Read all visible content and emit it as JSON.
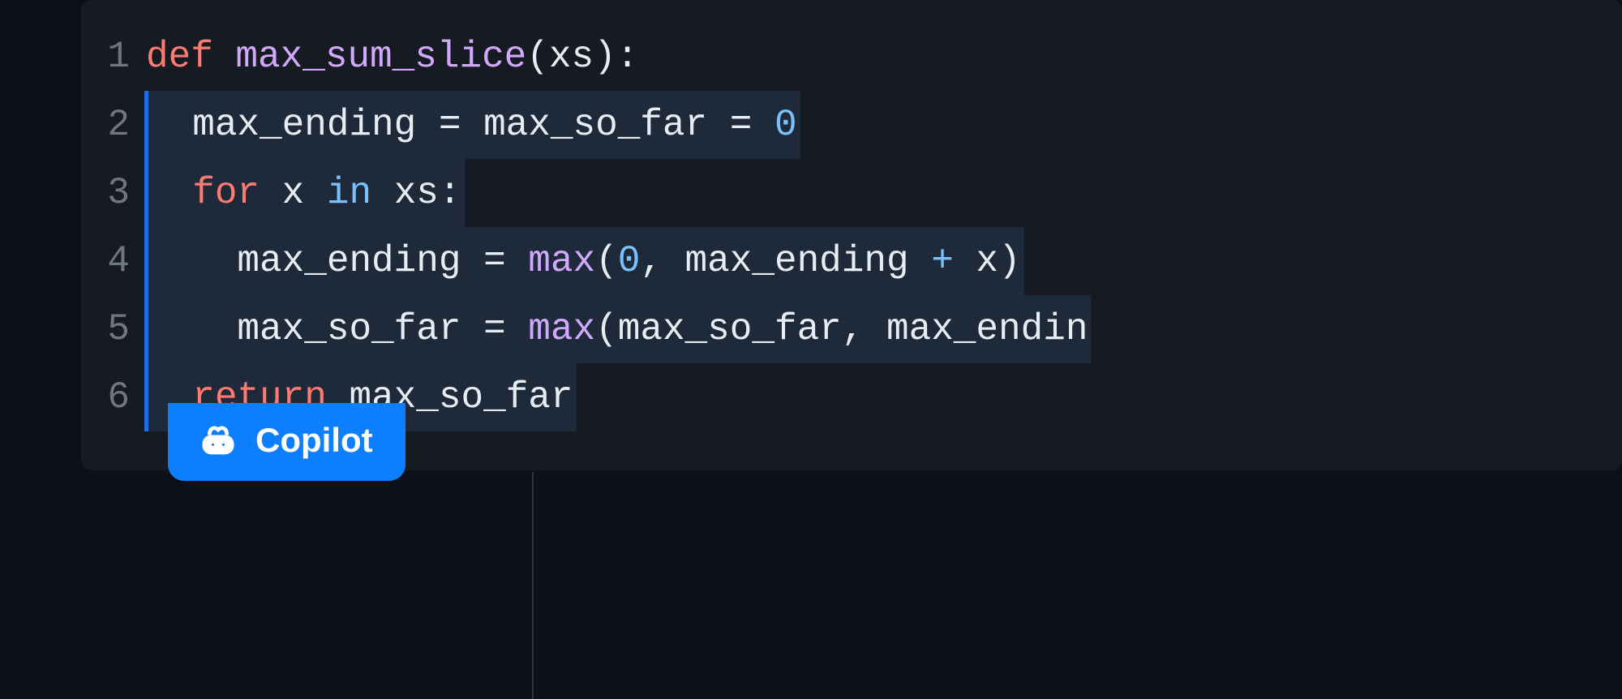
{
  "editor": {
    "lines": [
      {
        "num": "1",
        "tokens": [
          {
            "t": "def ",
            "c": "tok-keyword"
          },
          {
            "t": "max_sum_slice",
            "c": "tok-func"
          },
          {
            "t": "(xs):",
            "c": "tok-default"
          }
        ],
        "suggested": false
      },
      {
        "num": "2",
        "tokens": [
          {
            "t": "  max_ending ",
            "c": "tok-default"
          },
          {
            "t": "=",
            "c": "tok-default"
          },
          {
            "t": " max_so_far ",
            "c": "tok-default"
          },
          {
            "t": "=",
            "c": "tok-default"
          },
          {
            "t": " ",
            "c": "tok-default"
          },
          {
            "t": "0",
            "c": "tok-number"
          }
        ],
        "suggested": true
      },
      {
        "num": "3",
        "tokens": [
          {
            "t": "  ",
            "c": "tok-default"
          },
          {
            "t": "for",
            "c": "tok-keyword"
          },
          {
            "t": " x ",
            "c": "tok-default"
          },
          {
            "t": "in",
            "c": "tok-keyword-blue"
          },
          {
            "t": " xs:",
            "c": "tok-default"
          }
        ],
        "suggested": true
      },
      {
        "num": "4",
        "tokens": [
          {
            "t": "    max_ending ",
            "c": "tok-default"
          },
          {
            "t": "=",
            "c": "tok-default"
          },
          {
            "t": " ",
            "c": "tok-default"
          },
          {
            "t": "max",
            "c": "tok-builtin"
          },
          {
            "t": "(",
            "c": "tok-default"
          },
          {
            "t": "0",
            "c": "tok-number"
          },
          {
            "t": ", max_ending ",
            "c": "tok-default"
          },
          {
            "t": "+",
            "c": "tok-keyword-blue"
          },
          {
            "t": " x)",
            "c": "tok-default"
          }
        ],
        "suggested": true
      },
      {
        "num": "5",
        "tokens": [
          {
            "t": "    max_so_far ",
            "c": "tok-default"
          },
          {
            "t": "=",
            "c": "tok-default"
          },
          {
            "t": " ",
            "c": "tok-default"
          },
          {
            "t": "max",
            "c": "tok-builtin"
          },
          {
            "t": "(max_so_far, max_endin",
            "c": "tok-default"
          }
        ],
        "suggested": true
      },
      {
        "num": "6",
        "tokens": [
          {
            "t": "  ",
            "c": "tok-default"
          },
          {
            "t": "return",
            "c": "tok-keyword"
          },
          {
            "t": " max_so_far",
            "c": "tok-default"
          }
        ],
        "suggested": true
      }
    ]
  },
  "copilot": {
    "label": "Copilot"
  }
}
